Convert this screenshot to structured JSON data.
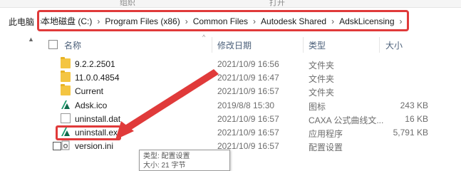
{
  "ribbon": {
    "left_label": "组织",
    "right_label": "打开"
  },
  "address_bar": {
    "root": "此电脑",
    "crumbs": [
      "本地磁盘 (C:)",
      "Program Files (x86)",
      "Common Files",
      "Autodesk Shared",
      "AdskLicensing"
    ],
    "separator": "›"
  },
  "columns": {
    "name": "名称",
    "date": "修改日期",
    "type": "类型",
    "size": "大小"
  },
  "files": [
    {
      "name": "9.2.2.2501",
      "date": "2021/10/9 16:56",
      "type": "文件夹",
      "size": "",
      "icon": "folder-icon"
    },
    {
      "name": "11.0.0.4854",
      "date": "2021/10/9 16:47",
      "type": "文件夹",
      "size": "",
      "icon": "folder-icon"
    },
    {
      "name": "Current",
      "date": "2021/10/9 16:57",
      "type": "文件夹",
      "size": "",
      "icon": "shortcut-folder-icon"
    },
    {
      "name": "Adsk.ico",
      "date": "2019/8/8 15:30",
      "type": "图标",
      "size": "243 KB",
      "icon": "autodesk-icon"
    },
    {
      "name": "uninstall.dat",
      "date": "2021/10/9 16:57",
      "type": "CAXA 公式曲线文...",
      "size": "16 KB",
      "icon": "document-icon"
    },
    {
      "name": "uninstall.exe",
      "date": "2021/10/9 16:57",
      "type": "应用程序",
      "size": "5,791 KB",
      "icon": "autodesk-exe-icon"
    },
    {
      "name": "version.ini",
      "date": "2021/10/9 16:57",
      "type": "配置设置",
      "size": "",
      "icon": "settings-file-icon"
    }
  ],
  "tooltip": {
    "line1": "类型: 配置设置",
    "line2": "大小: 21 字节"
  },
  "colors": {
    "highlight": "#e03a3a",
    "header_text": "#4c607a",
    "folder": "#f4c542",
    "autodesk_green": "#1f9d6f"
  }
}
